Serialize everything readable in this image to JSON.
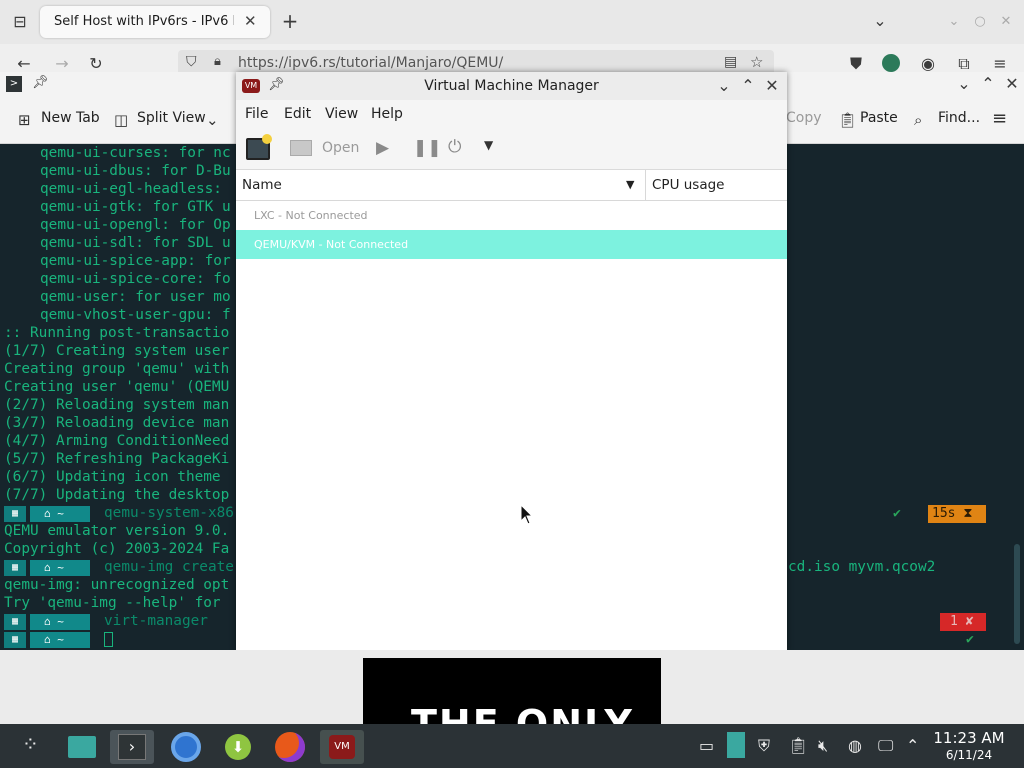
{
  "browser": {
    "tab_title": "Self Host with IPv6rs - IPv6 Po",
    "url": "https://ipv6.rs/tutorial/Manjaro/QEMU/"
  },
  "konsole": {
    "toolbar": {
      "new_tab": "New Tab",
      "split_view": "Split View",
      "copy": "Copy",
      "paste": "Paste",
      "find": "Find..."
    },
    "lines_indented": [
      "qemu-ui-curses: for nc",
      "qemu-ui-dbus: for D-Bu",
      "qemu-ui-egl-headless: ",
      "qemu-ui-gtk: for GTK u",
      "qemu-ui-opengl: for Op",
      "qemu-ui-sdl: for SDL u",
      "qemu-ui-spice-app: for",
      "qemu-ui-spice-core: fo",
      "qemu-user: for user mo",
      "qemu-vhost-user-gpu: f"
    ],
    "lines": [
      ":: Running post-transactio",
      "(1/7) Creating system user",
      "Creating group 'qemu' with",
      "Creating user 'qemu' (QEMU",
      "(2/7) Reloading system man",
      "(3/7) Reloading device man",
      "(4/7) Arming ConditionNeed",
      "(5/7) Refreshing PackageKi",
      "(6/7) Updating icon theme ",
      "(7/7) Updating the desktop"
    ],
    "prompt_home": "~",
    "cmd1": "qemu-system-x86",
    "out1": [
      "QEMU emulator version 9.0.",
      "Copyright (c) 2003-2024 Fa"
    ],
    "cmd2": "qemu-img create",
    "cmd2_tail": "cd.iso myvm.qcow2",
    "out2": [
      "qemu-img: unrecognized opt",
      "Try 'qemu-img --help' for "
    ],
    "cmd3": "virt-manager",
    "time_badge": "15s",
    "err_badge": "1",
    "check": "✔"
  },
  "vmm": {
    "title": "Virtual Machine Manager",
    "menu": [
      "File",
      "Edit",
      "View",
      "Help"
    ],
    "toolbar_open": "Open",
    "columns": {
      "name": "Name",
      "cpu": "CPU usage"
    },
    "connections": [
      {
        "label": "LXC - Not Connected",
        "selected": false
      },
      {
        "label": "QEMU/KVM - Not Connected",
        "selected": true
      }
    ],
    "selected_color": "#7df2df"
  },
  "video": {
    "text": "THE ONLY"
  },
  "clock": {
    "time": "11:23 AM",
    "date": "6/11/24"
  }
}
